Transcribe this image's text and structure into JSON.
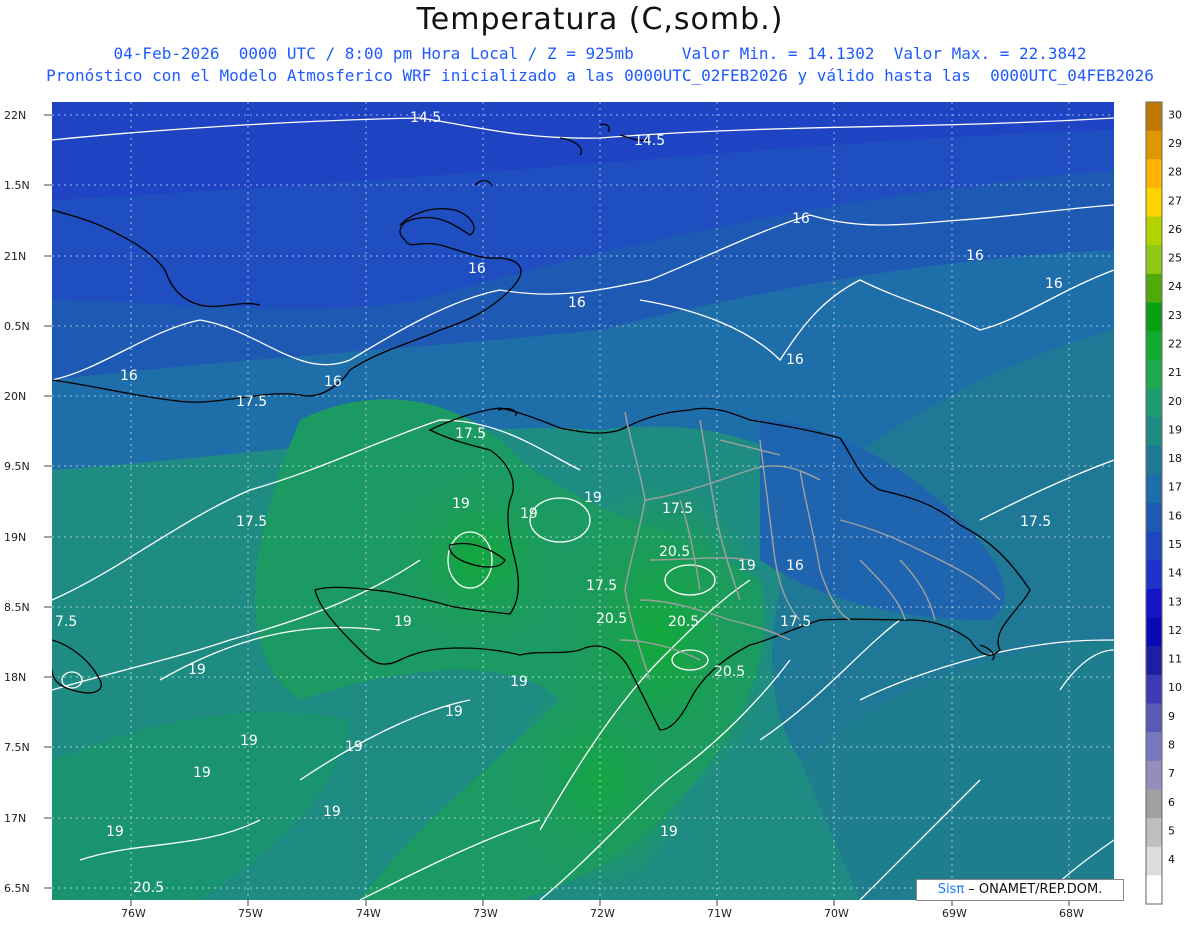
{
  "title": "Temperatura (C,somb.)",
  "subtitle_line1": "04-Feb-2026  0000 UTC / 8:00 pm Hora Local / Z = 925mb     Valor Min. = 14.1302  Valor Max. = 22.3842",
  "subtitle_line2": "Pronóstico con el Modelo Atmosferico WRF inicializado a las 0000UTC_02FEB2026 y válido hasta las  0000UTC_04FEB2026",
  "credit": {
    "brand": "Sisπ",
    "text": " – ONAMET/REP.DOM."
  },
  "map": {
    "lat_labels": [
      "22N",
      "1.5N",
      "21N",
      "0.5N",
      "20N",
      "9.5N",
      "19N",
      "8.5N",
      "18N",
      "7.5N",
      "17N",
      "6.5N"
    ],
    "lon_labels": [
      "76W",
      "75W",
      "74W",
      "73W",
      "72W",
      "71W",
      "70W",
      "69W",
      "68W"
    ],
    "contour_labels": [
      "14.5",
      "14.5",
      "16",
      "16",
      "16",
      "16",
      "16",
      "16",
      "16",
      "16",
      "17.5",
      "17.5",
      "17.5",
      "17.5",
      "17.5",
      "17.5",
      "17.5",
      "7.5",
      "19",
      "19",
      "19",
      "19",
      "19",
      "19",
      "19",
      "19",
      "19",
      "19",
      "19",
      "19",
      "19",
      "20.5",
      "20.5",
      "20.5",
      "20.5",
      "20.5",
      "16",
      "19"
    ]
  },
  "colorbar": {
    "labels": [
      "30",
      "29",
      "28",
      "27",
      "26",
      "25",
      "24",
      "23",
      "22",
      "21",
      "20",
      "19",
      "18",
      "17",
      "16",
      "15",
      "14",
      "13",
      "12",
      "11",
      "10",
      "9",
      "8",
      "7",
      "6",
      "5",
      "4"
    ],
    "colors": [
      "#c07800",
      "#e09600",
      "#ffb400",
      "#ffd200",
      "#b4d200",
      "#8cc814",
      "#50aa0a",
      "#0aa014",
      "#14aa32",
      "#1eaa50",
      "#1e9c6e",
      "#1e8c82",
      "#1e7896",
      "#1e6eaa",
      "#1e5ab4",
      "#1e46be",
      "#1e32c8",
      "#1414c8",
      "#0a0ab4",
      "#1e1ea0",
      "#3c3cb4",
      "#5a5ab4",
      "#7878be",
      "#968cbe",
      "#a0a0a0",
      "#bebebe",
      "#dcdcdc",
      "#ffffff"
    ]
  }
}
